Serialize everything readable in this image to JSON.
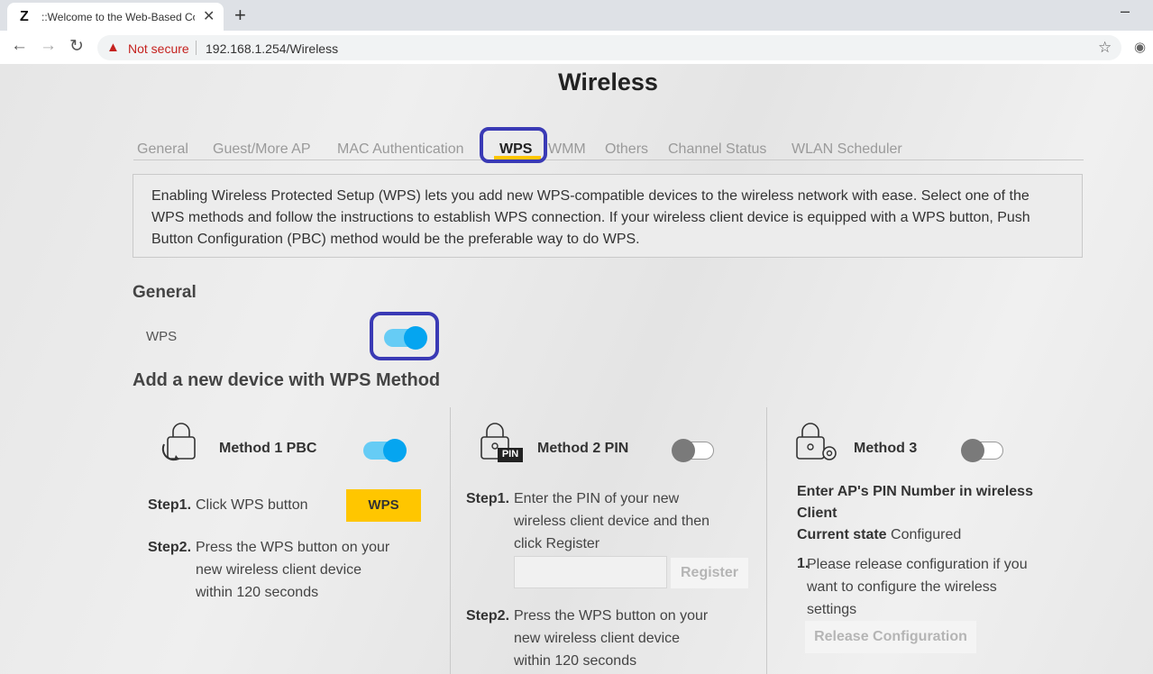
{
  "browser": {
    "tab_favicon": "Z",
    "tab_title": "::Welcome to the Web-Based Co",
    "close": "✕",
    "new_tab": "+",
    "minimize": "–",
    "not_secure": "Not secure",
    "url": "192.168.1.254/Wireless"
  },
  "page": {
    "title": "Wireless",
    "tabs": [
      {
        "label": "General"
      },
      {
        "label": "Guest/More AP"
      },
      {
        "label": "MAC Authentication"
      },
      {
        "label": "WPS"
      },
      {
        "label": "WMM"
      },
      {
        "label": "Others"
      },
      {
        "label": "Channel Status"
      },
      {
        "label": "WLAN Scheduler"
      }
    ],
    "active_tab": "WPS",
    "description": "Enabling Wireless Protected Setup (WPS) lets you add new WPS-compatible devices to the wireless network with ease. Select one of the WPS methods and follow the instructions to establish WPS connection. If your wireless client device is equipped with a WPS button, Push Button Configuration (PBC) method would be the preferable way to do WPS.",
    "general_heading": "General",
    "wps_label": "WPS",
    "wps_enabled": true,
    "add_heading": "Add a new device with WPS Method",
    "method1": {
      "title": "Method 1 PBC",
      "enabled": true,
      "step1_label": "Step1.",
      "step1_text": "Click WPS button",
      "wps_button": "WPS",
      "step2_label": "Step2.",
      "step2_lines": [
        "Press the WPS button on your",
        "new wireless client device",
        "within 120 seconds"
      ]
    },
    "method2": {
      "title": "Method 2 PIN",
      "enabled": false,
      "badge": "PIN",
      "step1_label": "Step1.",
      "step1_lines": [
        "Enter the PIN of your new",
        "wireless client device and then",
        "click Register"
      ],
      "pin_value": "",
      "register_button": "Register",
      "step2_label": "Step2.",
      "step2_lines": [
        "Press the WPS button on your",
        "new wireless client device",
        "within 120 seconds"
      ]
    },
    "method3": {
      "title": "Method 3",
      "enabled": false,
      "heading_lines": [
        "Enter AP's PIN Number in wireless",
        "Client"
      ],
      "state_label": "Current state",
      "state_value": "Configured",
      "note_number": "1.",
      "note_lines": [
        "Please release configuration if you",
        "want to configure the wireless",
        "settings"
      ],
      "release_button": "Release Configuration"
    }
  },
  "colors": {
    "accent": "#ffc600",
    "toggle_on": "#05a5f0",
    "highlight": "#3a3ab5",
    "warning": "#c5221f"
  }
}
